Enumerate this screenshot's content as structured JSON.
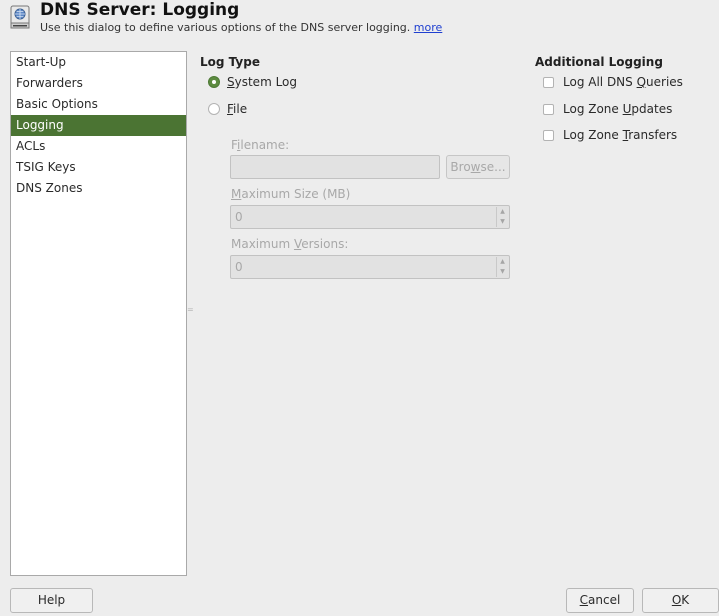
{
  "header": {
    "title": "DNS Server: Logging",
    "description": "Use this dialog to define various options of the DNS server logging.",
    "more_link": "more"
  },
  "sidebar": {
    "items": [
      {
        "label": "Start-Up"
      },
      {
        "label": "Forwarders"
      },
      {
        "label": "Basic Options"
      },
      {
        "label": "Logging",
        "selected": true
      },
      {
        "label": "ACLs"
      },
      {
        "label": "TSIG Keys"
      },
      {
        "label": "DNS Zones"
      }
    ]
  },
  "log_type": {
    "title": "Log Type",
    "system_log": {
      "pre": "",
      "key": "S",
      "post": "ystem Log",
      "checked": true
    },
    "file": {
      "pre": "",
      "key": "F",
      "post": "ile",
      "checked": false
    },
    "filename": {
      "pre": "F",
      "key": "i",
      "post": "lename:",
      "value": ""
    },
    "browse": {
      "pre": "Bro",
      "key": "w",
      "post": "se..."
    },
    "max_size": {
      "pre": "",
      "key": "M",
      "post": "aximum Size (MB)",
      "value": "0"
    },
    "max_versions": {
      "pre": "Maximum ",
      "key": "V",
      "post": "ersions:",
      "value": "0"
    }
  },
  "additional_logging": {
    "title": "Additional Logging",
    "queries": {
      "pre": "Log All DNS ",
      "key": "Q",
      "post": "ueries",
      "checked": false
    },
    "zone_updates": {
      "pre": "Log Zone ",
      "key": "U",
      "post": "pdates",
      "checked": false
    },
    "zone_transfers": {
      "pre": "Log Zone ",
      "key": "T",
      "post": "ransfers",
      "checked": false
    }
  },
  "footer": {
    "help": "Help",
    "cancel": {
      "pre": "",
      "key": "C",
      "post": "ancel"
    },
    "ok": {
      "pre": "",
      "key": "O",
      "post": "K"
    }
  },
  "colors": {
    "accent": "#4b7433",
    "link": "#1f3fd0",
    "background": "#ededed"
  },
  "icons": {
    "header": "dns-server-icon",
    "spin_up": "spin-up-arrow-icon",
    "spin_down": "spin-down-arrow-icon"
  }
}
